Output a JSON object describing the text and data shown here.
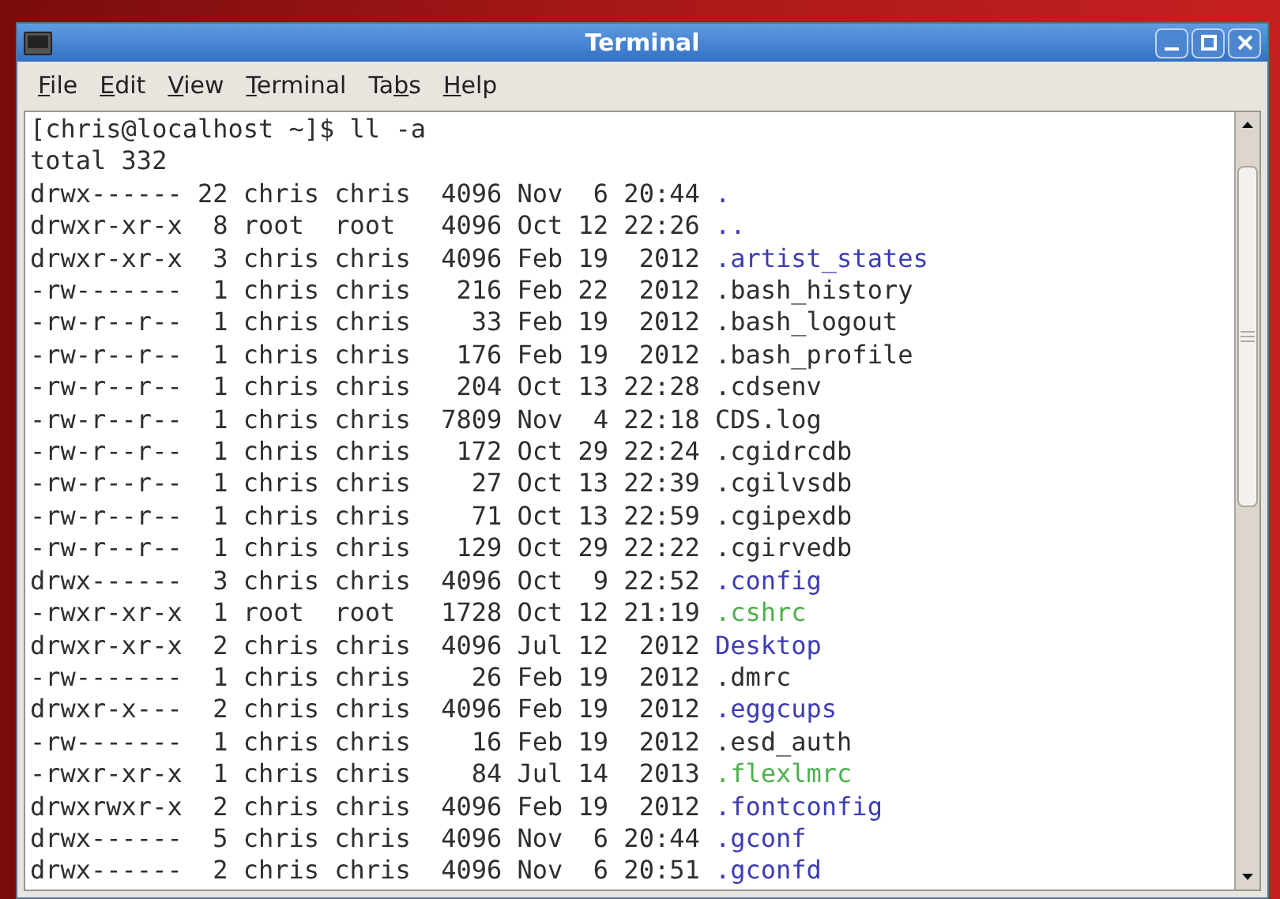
{
  "window": {
    "title": "Terminal"
  },
  "menu": [
    {
      "key": "F",
      "post": "ile"
    },
    {
      "key": "E",
      "post": "dit"
    },
    {
      "key": "V",
      "post": "iew"
    },
    {
      "key": "T",
      "post": "erminal"
    },
    {
      "pre": "Ta",
      "key": "b",
      "post": "s"
    },
    {
      "key": "H",
      "post": "elp"
    }
  ],
  "terminal": {
    "prompt": "[chris@localhost ~]$ ll -a",
    "total": "total 332",
    "entries": [
      {
        "details": "drwx------ 22 chris chris  4096 Nov  6 20:44",
        "name": ".",
        "kind": "directory"
      },
      {
        "details": "drwxr-xr-x  8 root  root   4096 Oct 12 22:26",
        "name": "..",
        "kind": "directory"
      },
      {
        "details": "drwxr-xr-x  3 chris chris  4096 Feb 19  2012",
        "name": ".artist_states",
        "kind": "directory"
      },
      {
        "details": "-rw-------  1 chris chris   216 Feb 22  2012",
        "name": ".bash_history",
        "kind": "file"
      },
      {
        "details": "-rw-r--r--  1 chris chris    33 Feb 19  2012",
        "name": ".bash_logout",
        "kind": "file"
      },
      {
        "details": "-rw-r--r--  1 chris chris   176 Feb 19  2012",
        "name": ".bash_profile",
        "kind": "file"
      },
      {
        "details": "-rw-r--r--  1 chris chris   204 Oct 13 22:28",
        "name": ".cdsenv",
        "kind": "file"
      },
      {
        "details": "-rw-r--r--  1 chris chris  7809 Nov  4 22:18",
        "name": "CDS.log",
        "kind": "file"
      },
      {
        "details": "-rw-r--r--  1 chris chris   172 Oct 29 22:24",
        "name": ".cgidrcdb",
        "kind": "file"
      },
      {
        "details": "-rw-r--r--  1 chris chris    27 Oct 13 22:39",
        "name": ".cgilvsdb",
        "kind": "file"
      },
      {
        "details": "-rw-r--r--  1 chris chris    71 Oct 13 22:59",
        "name": ".cgipexdb",
        "kind": "file"
      },
      {
        "details": "-rw-r--r--  1 chris chris   129 Oct 29 22:22",
        "name": ".cgirvedb",
        "kind": "file"
      },
      {
        "details": "drwx------  3 chris chris  4096 Oct  9 22:52",
        "name": ".config",
        "kind": "directory"
      },
      {
        "details": "-rwxr-xr-x  1 root  root   1728 Oct 12 21:19",
        "name": ".cshrc",
        "kind": "executable"
      },
      {
        "details": "drwxr-xr-x  2 chris chris  4096 Jul 12  2012",
        "name": "Desktop",
        "kind": "directory"
      },
      {
        "details": "-rw-------  1 chris chris    26 Feb 19  2012",
        "name": ".dmrc",
        "kind": "file"
      },
      {
        "details": "drwxr-x---  2 chris chris  4096 Feb 19  2012",
        "name": ".eggcups",
        "kind": "directory"
      },
      {
        "details": "-rw-------  1 chris chris    16 Feb 19  2012",
        "name": ".esd_auth",
        "kind": "file"
      },
      {
        "details": "-rwxr-xr-x  1 chris chris    84 Jul 14  2013",
        "name": ".flexlmrc",
        "kind": "executable"
      },
      {
        "details": "drwxrwxr-x  2 chris chris  4096 Feb 19  2012",
        "name": ".fontconfig",
        "kind": "directory"
      },
      {
        "details": "drwx------  5 chris chris  4096 Nov  6 20:44",
        "name": ".gconf",
        "kind": "directory"
      },
      {
        "details": "drwx------  2 chris chris  4096 Nov  6 20:51",
        "name": ".gconfd",
        "kind": "directory"
      }
    ]
  }
}
